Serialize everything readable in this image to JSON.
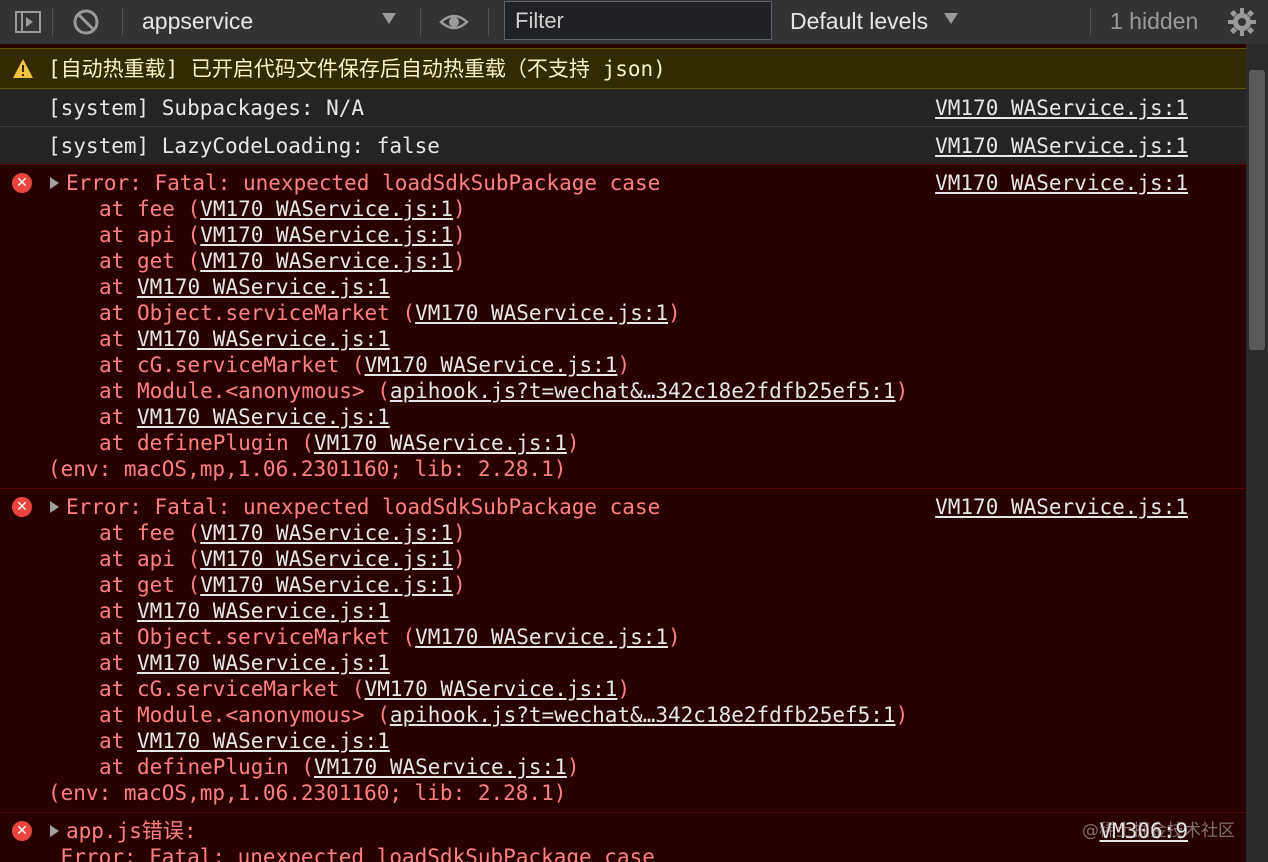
{
  "toolbar": {
    "context": "appservice",
    "filter_placeholder": "Filter",
    "levels": "Default levels",
    "hidden": "1 hidden"
  },
  "messages": {
    "warning": "[自动热重载] 已开启代码文件保存后自动热重载（不支持 json)",
    "info": [
      {
        "text": "[system] Subpackages: N/A",
        "source": "VM170 WAService.js:1"
      },
      {
        "text": "[system] LazyCodeLoading: false",
        "source": "VM170 WAService.js:1"
      }
    ],
    "error1": {
      "title": "Error: Fatal: unexpected loadSdkSubPackage case",
      "source": "VM170 WAService.js:1",
      "env": "(env: macOS,mp,1.06.2301160; lib: 2.28.1)"
    },
    "error2": {
      "title": "Error: Fatal: unexpected loadSdkSubPackage case",
      "source": "VM170 WAService.js:1",
      "env": "(env: macOS,mp,1.06.2301160; lib: 2.28.1)"
    },
    "error3": {
      "title": "app.js错误:",
      "source": "VM306:9",
      "detail": " Error: Fatal: unexpected loadSdkSubPackage case"
    }
  },
  "stack": {
    "at": "at",
    "fee": "fee",
    "api": "api",
    "get": "get",
    "object_service_market": "Object.serviceMarket",
    "cg_service_market": "cG.serviceMarket",
    "module_anonymous": "Module.<anonymous>",
    "define_plugin": "definePlugin",
    "wa_link": "VM170 WAService.js:1",
    "apihook_link": "apihook.js?t=wechat&…342c18e2fdfb25ef5:1",
    "open_paren": "(",
    "close_paren": ")"
  },
  "watermark": "@稀土掘金技术社区",
  "colors": {
    "error_bg": "#290000",
    "error_text": "#ff8080",
    "warning_bg": "#332b00",
    "toolbar_bg": "#333336"
  }
}
